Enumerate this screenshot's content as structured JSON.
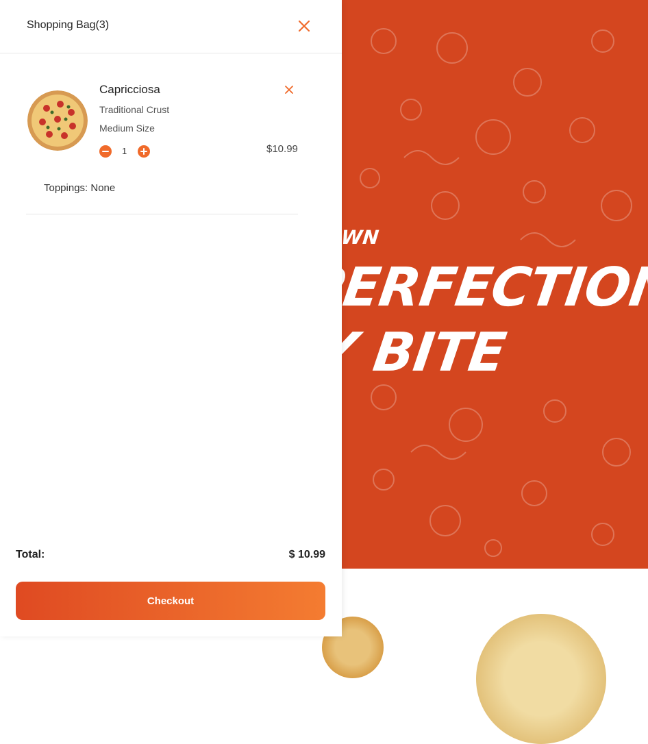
{
  "hero": {
    "subtitle": "N TOWN",
    "line1": "A PERFECTION",
    "line2": "ERY BITE",
    "background_color": "#d4461f"
  },
  "drawer": {
    "title": "Shopping Bag(3)",
    "close_icon": "close-icon",
    "items": [
      {
        "name": "Capricciosa",
        "crust": "Traditional Crust",
        "size": "Medium Size",
        "quantity": "1",
        "price": "$10.99",
        "toppings": "Toppings: None",
        "remove_icon": "close-icon",
        "minus_icon": "minus-icon",
        "plus_icon": "plus-icon",
        "image_icon": "pizza-image"
      }
    ],
    "total_label": "Total:",
    "total_value": "$ 10.99",
    "checkout_label": "Checkout",
    "accent_color": "#f06a2a"
  }
}
